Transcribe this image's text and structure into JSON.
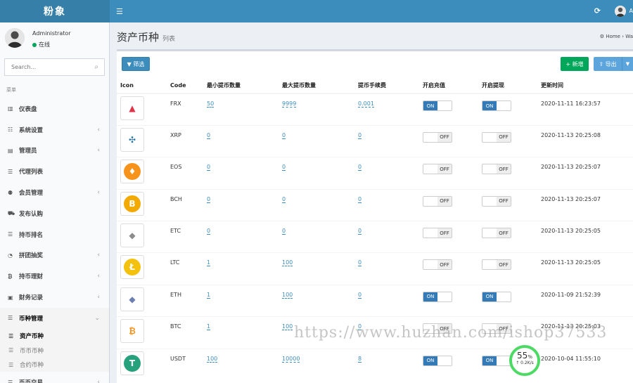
{
  "brand": "粉象",
  "topbar": {
    "user_initial": "A"
  },
  "user": {
    "name": "Administrator",
    "status": "在线"
  },
  "search": {
    "placeholder": "Search..."
  },
  "menu_header": "菜单",
  "menu": [
    {
      "label": "仪表盘",
      "icon": "bar-chart-icon",
      "chev": ""
    },
    {
      "label": "系统设置",
      "icon": "sliders-icon",
      "chev": "‹"
    },
    {
      "label": "管理员",
      "icon": "id-card-icon",
      "chev": "‹"
    },
    {
      "label": "代理列表",
      "icon": "list-icon",
      "chev": ""
    },
    {
      "label": "会员管理",
      "icon": "users-icon",
      "chev": "‹"
    },
    {
      "label": "发布认购",
      "icon": "cart-icon",
      "chev": ""
    },
    {
      "label": "持币排名",
      "icon": "list-icon",
      "chev": ""
    },
    {
      "label": "拼团抽奖",
      "icon": "dashboard-icon",
      "chev": "‹"
    },
    {
      "label": "持币理财",
      "icon": "bitcoin-icon",
      "chev": "‹"
    },
    {
      "label": "财务记录",
      "icon": "money-icon",
      "chev": "‹"
    },
    {
      "label": "币种管理",
      "icon": "list-icon",
      "chev": "⌄"
    }
  ],
  "submenu": [
    {
      "label": "资产币种"
    },
    {
      "label": "币币币种"
    },
    {
      "label": "合约币种"
    }
  ],
  "menu_last": "币币交易",
  "page": {
    "title": "资产币种",
    "subtitle": "列表",
    "breadcrumb": "Home  ›  Wa"
  },
  "toolbar": {
    "filter": "筛选",
    "add": "新增",
    "export": "导出"
  },
  "columns": [
    "Icon",
    "Code",
    "最小提币数量",
    "最大提币数量",
    "提币手续费",
    "开启充值",
    "开启提现",
    "更新时间"
  ],
  "switch": {
    "on": "ON",
    "off": "OFF"
  },
  "rows": [
    {
      "code": "FRX",
      "min": "50",
      "max": "9999",
      "fee": "0.001",
      "charge": "on",
      "withdraw": "on",
      "time": "2020-11-11 16:23:57",
      "color": "#ffffff",
      "glyph": "▲",
      "gcolor": "#e0334a"
    },
    {
      "code": "XRP",
      "min": "0",
      "max": "0",
      "fee": "0",
      "charge": "off",
      "withdraw": "off",
      "time": "2020-11-13 20:25:08",
      "color": "#ffffff",
      "glyph": "✣",
      "gcolor": "#1d6fa5"
    },
    {
      "code": "EOS",
      "min": "0",
      "max": "0",
      "fee": "0",
      "charge": "off",
      "withdraw": "off",
      "time": "2020-11-13 20:25:07",
      "color": "#f7931a",
      "glyph": "♦",
      "gcolor": "#ffffff"
    },
    {
      "code": "BCH",
      "min": "0",
      "max": "0",
      "fee": "0",
      "charge": "off",
      "withdraw": "off",
      "time": "2020-11-13 20:25:07",
      "color": "#f2a900",
      "glyph": "B",
      "gcolor": "#ffffff"
    },
    {
      "code": "ETC",
      "min": "0",
      "max": "0",
      "fee": "0",
      "charge": "off",
      "withdraw": "off",
      "time": "2020-11-13 20:25:05",
      "color": "#ffffff",
      "glyph": "◆",
      "gcolor": "#8c8c8c"
    },
    {
      "code": "LTC",
      "min": "1",
      "max": "100",
      "fee": "0",
      "charge": "off",
      "withdraw": "off",
      "time": "2020-11-13 20:25:05",
      "color": "#f4c20d",
      "glyph": "Ł",
      "gcolor": "#ffffff"
    },
    {
      "code": "ETH",
      "min": "1",
      "max": "100",
      "fee": "0",
      "charge": "on",
      "withdraw": "on",
      "time": "2020-11-09 21:52:39",
      "color": "#ffffff",
      "glyph": "◆",
      "gcolor": "#6c7fae"
    },
    {
      "code": "BTC",
      "min": "1",
      "max": "100",
      "fee": "0",
      "charge": "off",
      "withdraw": "off",
      "time": "2020-11-13 20:25:03",
      "color": "#ffffff",
      "glyph": "₿",
      "gcolor": "#f7931a"
    },
    {
      "code": "USDT",
      "min": "100",
      "max": "10000",
      "fee": "8",
      "charge": "on",
      "withdraw": "on",
      "time": "2020-10-04 11:55:10",
      "color": "#26a17b",
      "glyph": "T",
      "gcolor": "#ffffff"
    }
  ],
  "watermark": "https://www.huzhan.com/ishop37533",
  "gauge": {
    "pct": "55",
    "unit": "%",
    "speed": "↑ 0.2K/s"
  }
}
